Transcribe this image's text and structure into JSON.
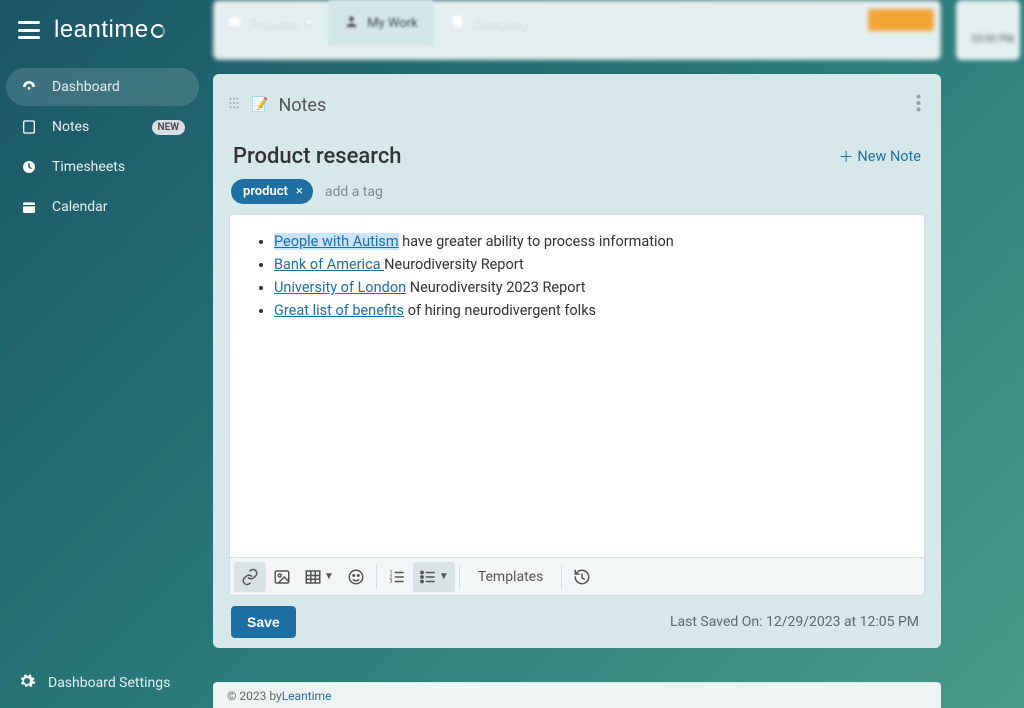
{
  "brand": "leantime",
  "topbar": {
    "projects": "Projects",
    "mywork": "My Work",
    "company": "Company"
  },
  "sidebar": {
    "items": [
      {
        "label": "Dashboard"
      },
      {
        "label": "Notes",
        "badge": "NEW"
      },
      {
        "label": "Timesheets"
      },
      {
        "label": "Calendar"
      }
    ],
    "settings": "Dashboard Settings"
  },
  "bg": {
    "time": "03:00 PM"
  },
  "panel": {
    "title": "Notes",
    "emoji": "📝",
    "note_title": "Product research",
    "new_note": "New Note",
    "tag": "product",
    "add_tag": "add a tag",
    "bullets": [
      {
        "link": "People with Autism",
        "rest": " have greater ability to process information",
        "hl": true
      },
      {
        "link": "Bank of America ",
        "rest": "Neurodiversity Report"
      },
      {
        "link": "University of London",
        "rest": " Neurodiversity 2023 Report"
      },
      {
        "link": "Great list of benefits",
        "rest": " of hiring neurodivergent folks"
      }
    ],
    "templates": "Templates",
    "save": "Save",
    "saved": "Last Saved On: 12/29/2023 at 12:05 PM"
  },
  "footer": {
    "prefix": "© 2023 by ",
    "link": "Leantime"
  }
}
